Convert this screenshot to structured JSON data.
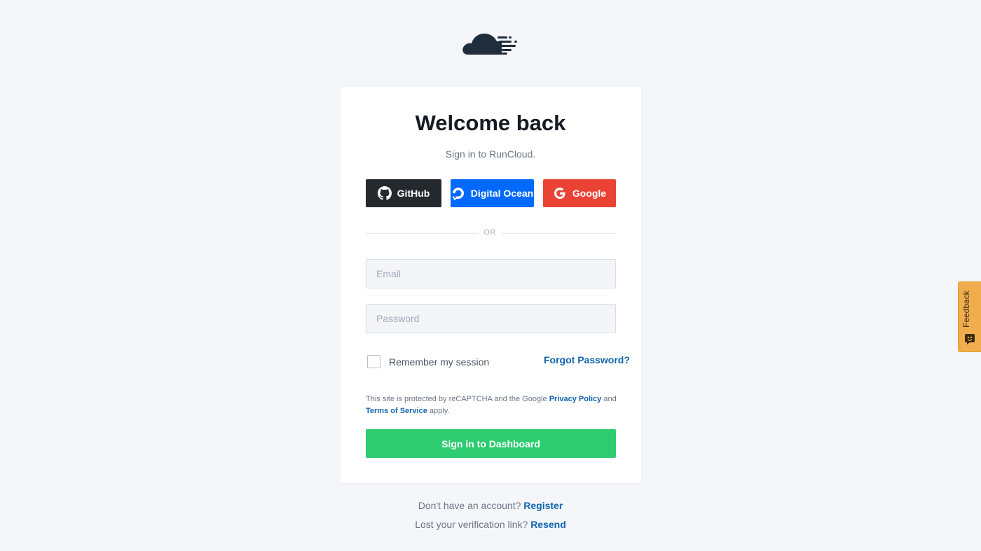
{
  "brand": {
    "logo_icon": "cloud-logo-icon"
  },
  "login": {
    "title": "Welcome back",
    "subtitle": "Sign in to RunCloud.",
    "oauth": {
      "github": {
        "label": "GitHub",
        "icon": "github-icon",
        "color": "#24292e"
      },
      "digitalocean": {
        "label": "Digital Ocean",
        "icon": "digitalocean-icon",
        "color": "#0069ff"
      },
      "google": {
        "label": "Google",
        "icon": "google-icon",
        "color": "#ea4335"
      }
    },
    "divider": "OR",
    "email": {
      "placeholder": "Email",
      "value": ""
    },
    "password": {
      "placeholder": "Password",
      "value": ""
    },
    "remember_label": "Remember my session",
    "remember_checked": false,
    "forgot_label": "Forgot Password?",
    "recaptcha": {
      "prefix": "This site is protected by reCAPTCHA and the Google",
      "privacy_link": "Privacy Policy",
      "and": "and",
      "terms_link": "Terms of Service",
      "suffix": "apply."
    },
    "submit_label": "Sign in to Dashboard",
    "submit_color": "#2ecc71"
  },
  "footer": {
    "no_account": "Don't have an account?",
    "register_link": "Register",
    "lost_link_text": "Lost your verification link?",
    "resend_link": "Resend"
  },
  "feedback": {
    "label": "Feedback",
    "icon": "feedback-icon",
    "color": "#f0ad4e"
  },
  "colors": {
    "background": "#f4f6fa",
    "link": "#1164ae"
  }
}
